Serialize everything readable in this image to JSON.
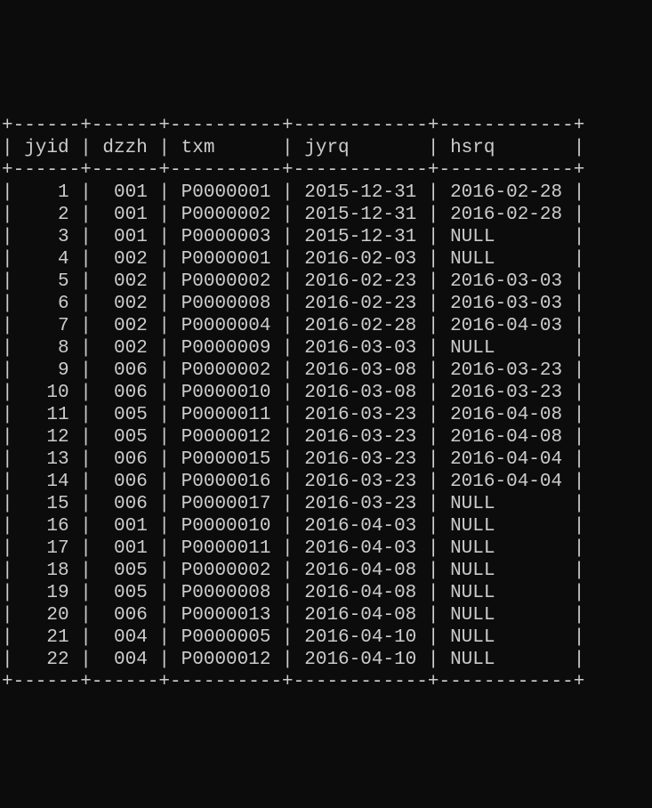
{
  "chart_data": {
    "type": "table",
    "columns": [
      "jyid",
      "dzzh",
      "txm",
      "jyrq",
      "hsrq"
    ],
    "rows": [
      {
        "jyid": "1",
        "dzzh": "001",
        "txm": "P0000001",
        "jyrq": "2015-12-31",
        "hsrq": "2016-02-28"
      },
      {
        "jyid": "2",
        "dzzh": "001",
        "txm": "P0000002",
        "jyrq": "2015-12-31",
        "hsrq": "2016-02-28"
      },
      {
        "jyid": "3",
        "dzzh": "001",
        "txm": "P0000003",
        "jyrq": "2015-12-31",
        "hsrq": "NULL"
      },
      {
        "jyid": "4",
        "dzzh": "002",
        "txm": "P0000001",
        "jyrq": "2016-02-03",
        "hsrq": "NULL"
      },
      {
        "jyid": "5",
        "dzzh": "002",
        "txm": "P0000002",
        "jyrq": "2016-02-23",
        "hsrq": "2016-03-03"
      },
      {
        "jyid": "6",
        "dzzh": "002",
        "txm": "P0000008",
        "jyrq": "2016-02-23",
        "hsrq": "2016-03-03"
      },
      {
        "jyid": "7",
        "dzzh": "002",
        "txm": "P0000004",
        "jyrq": "2016-02-28",
        "hsrq": "2016-04-03"
      },
      {
        "jyid": "8",
        "dzzh": "002",
        "txm": "P0000009",
        "jyrq": "2016-03-03",
        "hsrq": "NULL"
      },
      {
        "jyid": "9",
        "dzzh": "006",
        "txm": "P0000002",
        "jyrq": "2016-03-08",
        "hsrq": "2016-03-23"
      },
      {
        "jyid": "10",
        "dzzh": "006",
        "txm": "P0000010",
        "jyrq": "2016-03-08",
        "hsrq": "2016-03-23"
      },
      {
        "jyid": "11",
        "dzzh": "005",
        "txm": "P0000011",
        "jyrq": "2016-03-23",
        "hsrq": "2016-04-08"
      },
      {
        "jyid": "12",
        "dzzh": "005",
        "txm": "P0000012",
        "jyrq": "2016-03-23",
        "hsrq": "2016-04-08"
      },
      {
        "jyid": "13",
        "dzzh": "006",
        "txm": "P0000015",
        "jyrq": "2016-03-23",
        "hsrq": "2016-04-04"
      },
      {
        "jyid": "14",
        "dzzh": "006",
        "txm": "P0000016",
        "jyrq": "2016-03-23",
        "hsrq": "2016-04-04"
      },
      {
        "jyid": "15",
        "dzzh": "006",
        "txm": "P0000017",
        "jyrq": "2016-03-23",
        "hsrq": "NULL"
      },
      {
        "jyid": "16",
        "dzzh": "001",
        "txm": "P0000010",
        "jyrq": "2016-04-03",
        "hsrq": "NULL"
      },
      {
        "jyid": "17",
        "dzzh": "001",
        "txm": "P0000011",
        "jyrq": "2016-04-03",
        "hsrq": "NULL"
      },
      {
        "jyid": "18",
        "dzzh": "005",
        "txm": "P0000002",
        "jyrq": "2016-04-08",
        "hsrq": "NULL"
      },
      {
        "jyid": "19",
        "dzzh": "005",
        "txm": "P0000008",
        "jyrq": "2016-04-08",
        "hsrq": "NULL"
      },
      {
        "jyid": "20",
        "dzzh": "006",
        "txm": "P0000013",
        "jyrq": "2016-04-08",
        "hsrq": "NULL"
      },
      {
        "jyid": "21",
        "dzzh": "004",
        "txm": "P0000005",
        "jyrq": "2016-04-10",
        "hsrq": "NULL"
      },
      {
        "jyid": "22",
        "dzzh": "004",
        "txm": "P0000012",
        "jyrq": "2016-04-10",
        "hsrq": "NULL"
      }
    ]
  },
  "widths": {
    "jyid": 6,
    "dzzh": 6,
    "txm": 10,
    "jyrq": 12,
    "hsrq": 12
  }
}
